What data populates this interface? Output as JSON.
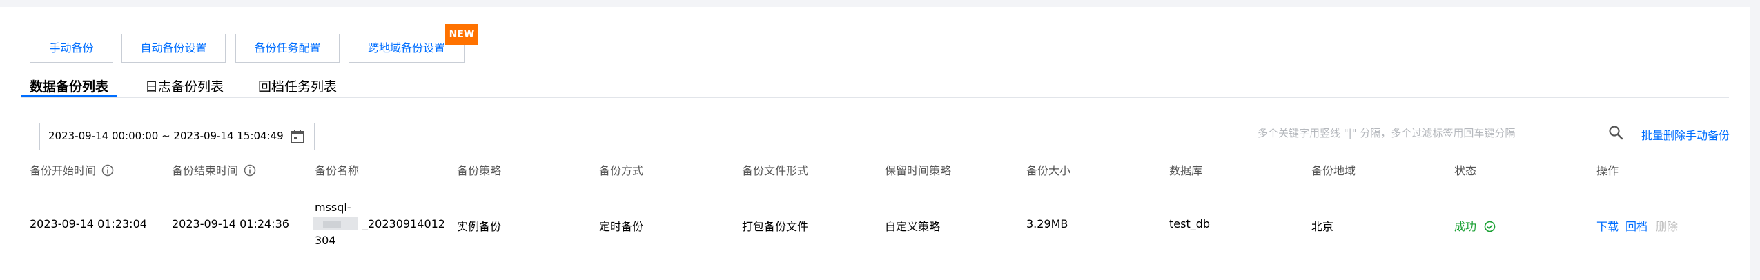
{
  "toolbar": {
    "manual_backup": "手动备份",
    "auto_backup_settings": "自动备份设置",
    "backup_task_config": "备份任务配置",
    "cross_region_backup": "跨地域备份设置",
    "new_badge": "NEW"
  },
  "tabs": [
    {
      "label": "数据备份列表",
      "active": true
    },
    {
      "label": "日志备份列表",
      "active": false
    },
    {
      "label": "回档任务列表",
      "active": false
    }
  ],
  "filter": {
    "date_range": "2023-09-14 00:00:00  ~ 2023-09-14 15:04:49",
    "calendar_icon": "calendar-icon",
    "search_placeholder": "多个关键字用竖线 \"|\" 分隔，多个过滤标签用回车键分隔",
    "search_icon": "search-icon",
    "bulk_delete": "批量删除手动备份"
  },
  "table": {
    "columns": [
      "备份开始时间",
      "备份结束时间",
      "备份名称",
      "备份策略",
      "备份方式",
      "备份文件形式",
      "保留时间策略",
      "备份大小",
      "数据库",
      "备份地域",
      "状态",
      "操作"
    ],
    "rows": [
      {
        "start_time": "2023-09-14 01:23:04",
        "end_time": "2023-09-14 01:24:36",
        "name_line1": "mssql-",
        "name_line2": "_20230914012",
        "name_line3": "304",
        "strategy": "实例备份",
        "method": "定时备份",
        "file_format": "打包备份文件",
        "retention": "自定义策略",
        "size": "3.29MB",
        "database": "test_db",
        "region": "北京",
        "status": "成功",
        "actions": {
          "download": "下载",
          "rollback": "回档",
          "delete": "删除"
        }
      }
    ]
  },
  "colors": {
    "accent": "#006eff",
    "success": "#1aa033",
    "badge": "#ff7200",
    "border": "#c9ced6"
  }
}
